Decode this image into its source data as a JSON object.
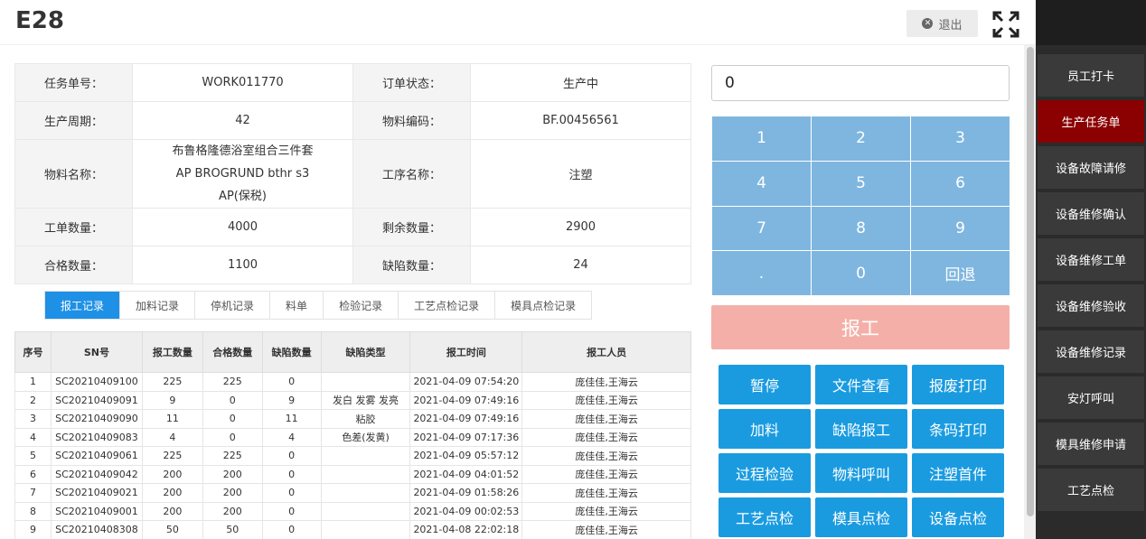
{
  "header": {
    "title": "E28",
    "logout_label": "退出"
  },
  "sidebar": {
    "items": [
      {
        "label": "员工打卡",
        "active": false
      },
      {
        "label": "生产任务单",
        "active": true
      },
      {
        "label": "设备故障请修",
        "active": false
      },
      {
        "label": "设备维修确认",
        "active": false
      },
      {
        "label": "设备维修工单",
        "active": false
      },
      {
        "label": "设备维修验收",
        "active": false
      },
      {
        "label": "设备维修记录",
        "active": false
      },
      {
        "label": "安灯呼叫",
        "active": false
      },
      {
        "label": "模具维修申请",
        "active": false
      },
      {
        "label": "工艺点检",
        "active": false
      }
    ]
  },
  "info": {
    "rows": [
      {
        "l1": "任务单号：",
        "v1": "WORK011770",
        "l2": "订单状态：",
        "v2": "生产中"
      },
      {
        "l1": "生产周期：",
        "v1": "42",
        "l2": "物料编码：",
        "v2": "BF.00456561"
      },
      {
        "l1": "物料名称：",
        "v1": "布鲁格隆德浴室组合三件套 AP BROGRUND bthr s3 AP(保税)",
        "l2": "工序名称：",
        "v2": "注塑"
      },
      {
        "l1": "工单数量：",
        "v1": "4000",
        "l2": "剩余数量：",
        "v2": "2900"
      },
      {
        "l1": "合格数量：",
        "v1": "1100",
        "l2": "缺陷数量：",
        "v2": "24"
      }
    ]
  },
  "tabs": [
    {
      "label": "报工记录",
      "active": true
    },
    {
      "label": "加料记录",
      "active": false
    },
    {
      "label": "停机记录",
      "active": false
    },
    {
      "label": "料单",
      "active": false
    },
    {
      "label": "检验记录",
      "active": false
    },
    {
      "label": "工艺点检记录",
      "active": false
    },
    {
      "label": "模具点检记录",
      "active": false
    }
  ],
  "records": {
    "columns": [
      "序号",
      "SN号",
      "报工数量",
      "合格数量",
      "缺陷数量",
      "缺陷类型",
      "报工时间",
      "报工人员"
    ],
    "rows": [
      [
        "1",
        "SC20210409100",
        "225",
        "225",
        "0",
        "",
        "2021-04-09 07:54:20",
        "庞佳佳,王海云"
      ],
      [
        "2",
        "SC20210409091",
        "9",
        "0",
        "9",
        "发白 发雾 发亮",
        "2021-04-09 07:49:16",
        "庞佳佳,王海云"
      ],
      [
        "3",
        "SC20210409090",
        "11",
        "0",
        "11",
        "粘胶",
        "2021-04-09 07:49:16",
        "庞佳佳,王海云"
      ],
      [
        "4",
        "SC20210409083",
        "4",
        "0",
        "4",
        "色差(发黄)",
        "2021-04-09 07:17:36",
        "庞佳佳,王海云"
      ],
      [
        "5",
        "SC20210409061",
        "225",
        "225",
        "0",
        "",
        "2021-04-09 05:57:12",
        "庞佳佳,王海云"
      ],
      [
        "6",
        "SC20210409042",
        "200",
        "200",
        "0",
        "",
        "2021-04-09 04:01:52",
        "庞佳佳,王海云"
      ],
      [
        "7",
        "SC20210409021",
        "200",
        "200",
        "0",
        "",
        "2021-04-09 01:58:26",
        "庞佳佳,王海云"
      ],
      [
        "8",
        "SC20210409001",
        "200",
        "200",
        "0",
        "",
        "2021-04-09 00:02:53",
        "庞佳佳,王海云"
      ],
      [
        "9",
        "SC20210408308",
        "50",
        "50",
        "0",
        "",
        "2021-04-08 22:02:18",
        "庞佳佳,王海云"
      ]
    ]
  },
  "number_input": {
    "value": "0"
  },
  "keypad": [
    "1",
    "2",
    "3",
    "4",
    "5",
    "6",
    "7",
    "8",
    "9",
    ".",
    "0",
    "回退"
  ],
  "report_button": "报工",
  "actions": [
    "暂停",
    "文件查看",
    "报废打印",
    "加料",
    "缺陷报工",
    "条码打印",
    "过程检验",
    "物料呼叫",
    "注塑首件",
    "工艺点检",
    "模具点检",
    "设备点检"
  ],
  "colors": {
    "accent": "#1a9be0",
    "sidebar_active": "#8b0000",
    "keypad": "#7fb6df",
    "report_button": "#f4b0a8"
  }
}
